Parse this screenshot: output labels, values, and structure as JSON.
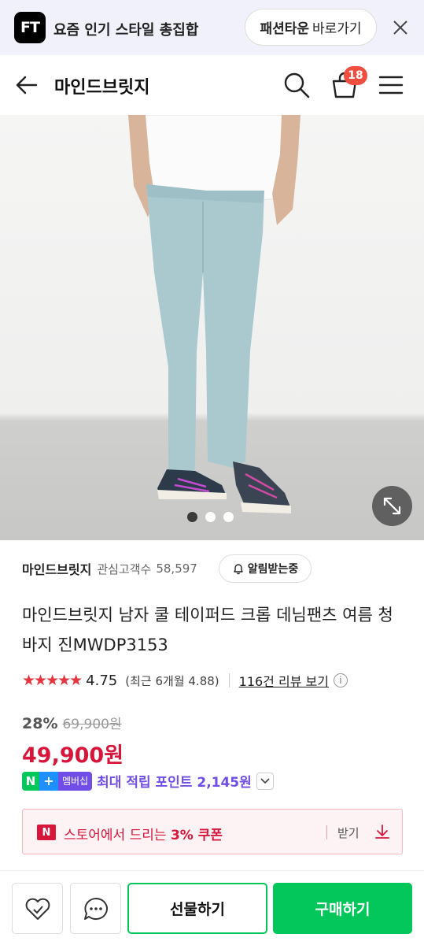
{
  "promo": {
    "logo": "FT",
    "text": "요즘 인기 스타일 총집합",
    "button_bold": "패션타운",
    "button_rest": "바로가기"
  },
  "header": {
    "title": "마인드브릿지",
    "cart_count": "18"
  },
  "gallery": {
    "dots": 3,
    "active_dot": 0
  },
  "store": {
    "name": "마인드브릿지",
    "follower_label": "관심고객수",
    "follower_count": "58,597",
    "alarm_label": "알림받는중"
  },
  "product": {
    "title": "마인드브릿지 남자 쿨 테이퍼드 크롭 데님팬츠 여름 청바지 진MWDP3153",
    "stars": "★★★★★",
    "rating": "4.75",
    "recent_rating": "(최근 6개월 4.88)",
    "review_link": "116건 리뷰 보기",
    "discount": "28%",
    "original_price": "69,900원",
    "sale_price": "49,900원"
  },
  "points": {
    "badge_n": "N",
    "badge_plus": "+",
    "badge_membership": "멤버십",
    "text": "최대 적립 포인트 2,145원"
  },
  "coupon": {
    "badge": "N",
    "text_prefix": "스토어에서 드리는 ",
    "text_bold": "3% 쿠폰",
    "get_label": "받기"
  },
  "bottom": {
    "gift_label": "선물하기",
    "buy_label": "구매하기"
  },
  "colors": {
    "accent_green": "#03c75a",
    "price_red": "#d8163c",
    "membership_purple": "#6f4de6",
    "badge_red": "#f04e3e"
  }
}
